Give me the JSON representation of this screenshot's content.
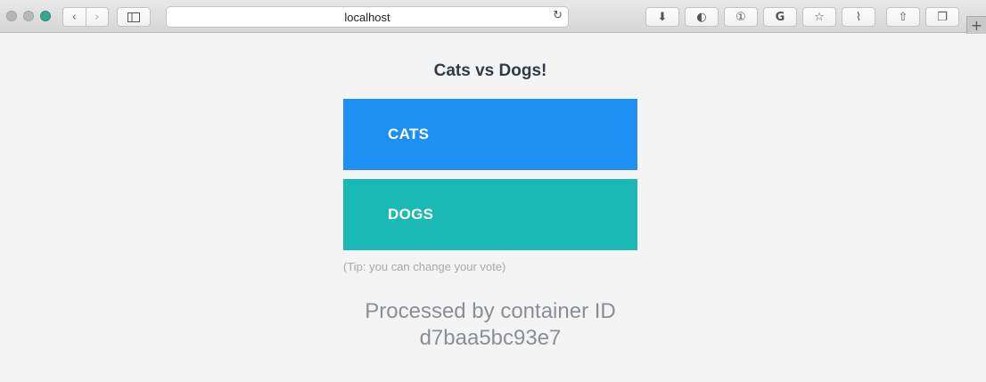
{
  "browser": {
    "url": "localhost",
    "back_glyph": "‹",
    "forward_glyph": "›",
    "sidebar_icon": "sidebar-icon",
    "reload_glyph": "↻",
    "extensions": [
      {
        "name": "download-icon",
        "glyph": "⬇"
      },
      {
        "name": "toggle-icon",
        "glyph": "◐"
      },
      {
        "name": "password-icon",
        "glyph": "①"
      },
      {
        "name": "grammarly-icon",
        "glyph": "G"
      },
      {
        "name": "star-icon",
        "glyph": "☆"
      },
      {
        "name": "rss-icon",
        "glyph": "⌇"
      },
      {
        "name": "share-icon",
        "glyph": "⇧"
      },
      {
        "name": "tabs-icon",
        "glyph": "❐"
      }
    ],
    "new_tab_glyph": "+"
  },
  "page": {
    "title": "Cats vs Dogs!",
    "options": [
      {
        "label": "CATS",
        "color": "#1e8ff3"
      },
      {
        "label": "DOGS",
        "color": "#1bb9b6"
      }
    ],
    "tip": "(Tip: you can change your vote)",
    "processed_line1": "Processed by container ID",
    "processed_line2": "d7baa5bc93e7"
  }
}
